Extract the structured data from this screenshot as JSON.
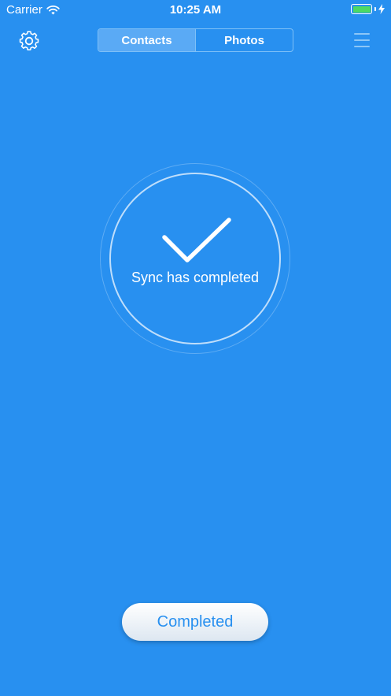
{
  "status_bar": {
    "carrier": "Carrier",
    "time": "10:25 AM",
    "battery_color": "#4cd964"
  },
  "nav": {
    "settings_icon": "gear-icon",
    "tabs": [
      {
        "label": "Contacts",
        "selected": true
      },
      {
        "label": "Photos",
        "selected": false
      }
    ],
    "menu_icon": "hamburger-menu-icon"
  },
  "sync": {
    "icon": "checkmark-icon",
    "message": "Sync has completed"
  },
  "footer": {
    "button_label": "Completed"
  },
  "colors": {
    "background": "#2890f0",
    "accent": "#2890f0"
  }
}
